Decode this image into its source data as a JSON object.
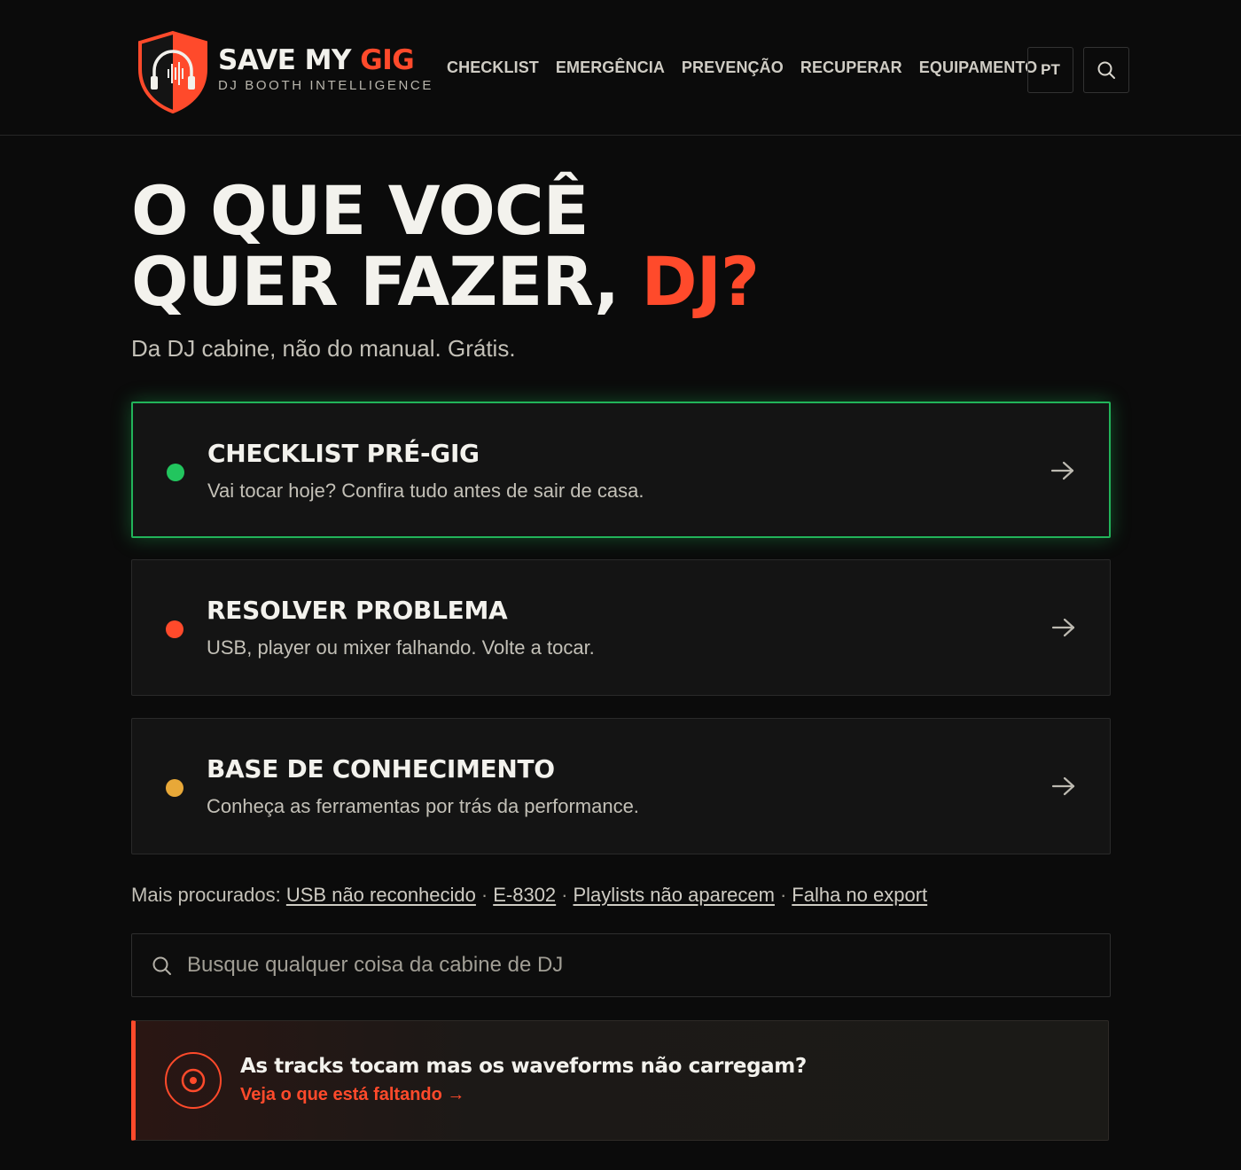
{
  "brand": {
    "name_part1": "SAVE MY ",
    "name_part2": "GIG",
    "tagline": "DJ BOOTH INTELLIGENCE"
  },
  "nav": {
    "items": [
      {
        "label": "CHECKLIST"
      },
      {
        "label": "EMERGÊNCIA"
      },
      {
        "label": "PREVENÇÃO"
      },
      {
        "label": "RECUPERAR"
      },
      {
        "label": "EQUIPAMENTO"
      }
    ],
    "language": "PT",
    "search_icon": "search-icon"
  },
  "hero": {
    "line1": "O QUE VOCÊ",
    "line2_main": "QUER FAZER, ",
    "line2_accent": "DJ?",
    "subtitle": "Da DJ cabine, não do manual. Grátis."
  },
  "cards": [
    {
      "title": "CHECKLIST PRÉ-GIG",
      "description": "Vai tocar hoje? Confira tudo antes de sair de casa.",
      "dot_color": "#22c55e",
      "active": true
    },
    {
      "title": "RESOLVER PROBLEMA",
      "description": "USB, player ou mixer falhando. Volte a tocar.",
      "dot_color": "#ff4a2b",
      "active": false
    },
    {
      "title": "BASE DE CONHECIMENTO",
      "description": "Conheça as ferramentas por trás da performance.",
      "dot_color": "#e8a838",
      "active": false
    }
  ],
  "popular": {
    "label": "Mais procurados: ",
    "links": [
      {
        "label": "USB não reconhecido"
      },
      {
        "label": "E-8302"
      },
      {
        "label": "Playlists não aparecem"
      },
      {
        "label": "Falha no export"
      }
    ],
    "separator": "·"
  },
  "search": {
    "placeholder": "Busque qualquer coisa da cabine de DJ",
    "value": ""
  },
  "alert": {
    "title": "As tracks tocam mas os waveforms não carregam?",
    "link": "Veja o que está faltando →",
    "icon": "vinyl-record-icon"
  },
  "colors": {
    "accent": "#ff4a2b",
    "success": "#22c55e",
    "warning": "#e8a838",
    "background": "#0b0b0b"
  }
}
